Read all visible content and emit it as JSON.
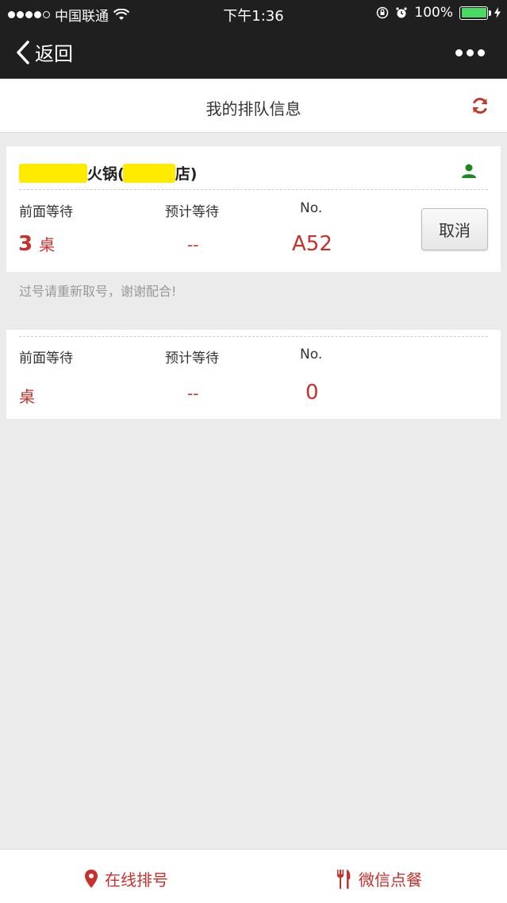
{
  "status_bar": {
    "carrier": "中国联通",
    "time": "下午1:36",
    "battery": "100%"
  },
  "nav": {
    "back_label": "返回"
  },
  "page": {
    "title": "我的排队信息"
  },
  "queue_card": {
    "shop_name_mid": "火锅(",
    "shop_name_end": "店)",
    "labels": {
      "ahead": "前面等待",
      "estimate": "预计等待",
      "number": "No."
    },
    "ahead_count": "3",
    "ahead_unit": "桌",
    "estimate_value": "--",
    "number_value": "A52",
    "cancel_label": "取消"
  },
  "notice": "过号请重新取号，谢谢配合!",
  "empty_card": {
    "labels": {
      "ahead": "前面等待",
      "estimate": "预计等待",
      "number": "No."
    },
    "ahead_unit": "桌",
    "estimate_value": "--",
    "number_value": "0"
  },
  "bottom_tabs": [
    {
      "label": "在线排号",
      "icon": "location-pin-icon"
    },
    {
      "label": "微信点餐",
      "icon": "fork-knife-icon"
    }
  ],
  "colors": {
    "accent": "#c9302c",
    "user_icon": "#1a8a1a",
    "refresh_icon": "#c0392b",
    "mask": "#ffeb00"
  }
}
